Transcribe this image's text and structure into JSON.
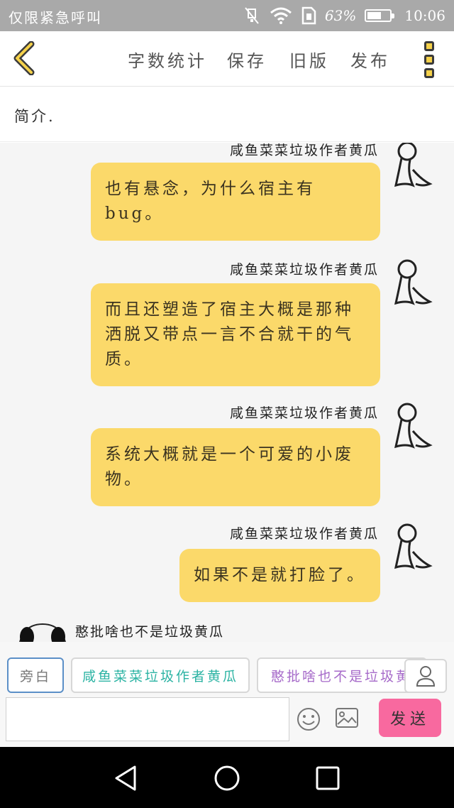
{
  "status_bar": {
    "carrier": "仅限紧急呼叫",
    "battery": "63%",
    "battery_level": 0.63,
    "time": "10:06",
    "icons": [
      "mute-icon",
      "wifi-icon",
      "sim-icon",
      "battery-icon"
    ]
  },
  "toolbar": {
    "word_count": "字数统计",
    "save": "保存",
    "old_version": "旧版",
    "publish": "发布"
  },
  "intro": {
    "label": "简介."
  },
  "messages": [
    {
      "sender": "咸鱼菜菜垃圾作者黄瓜",
      "text_line1": "也有悬念，为什么宿主有",
      "text_line2": "bug。"
    },
    {
      "sender": "咸鱼菜菜垃圾作者黄瓜",
      "text_line1": "而且还塑造了宿主大概是那种",
      "text_line2": "洒脱又带点一言不合就干的气",
      "text_line3": "质。"
    },
    {
      "sender": "咸鱼菜菜垃圾作者黄瓜",
      "text_line1": "系统大概就是一个可爱的小废",
      "text_line2": "物。"
    },
    {
      "sender": "咸鱼菜菜垃圾作者黄瓜",
      "text_line1": "如果不是就打脸了。"
    }
  ],
  "partial_message": {
    "sender": "憨批啥也不是垃圾黄瓜"
  },
  "roles": {
    "narration": "旁白",
    "role1": "咸鱼菜菜垃圾作者黄瓜",
    "role1_color": "#2bb3a3",
    "role2": "憨批啥也不是垃圾黄瓜",
    "role2_color": "#a66ac9"
  },
  "composer": {
    "input_value": "",
    "send": "发送"
  },
  "colors": {
    "bubble": "#fbd96a",
    "send_button": "#f8699f",
    "accent_yellow": "#f5d14a"
  }
}
